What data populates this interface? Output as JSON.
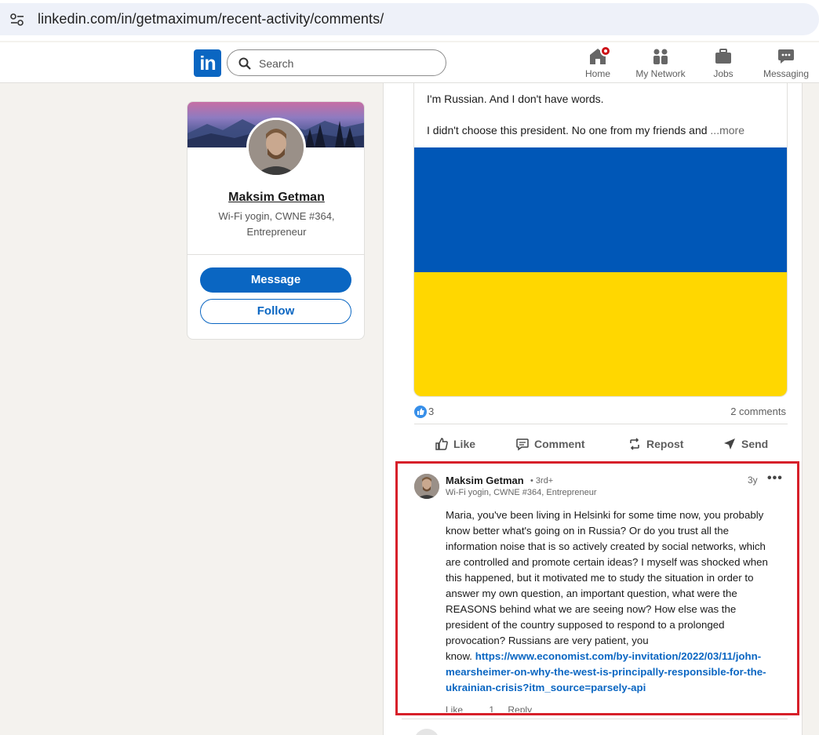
{
  "browser": {
    "url": "linkedin.com/in/getmaximum/recent-activity/comments/"
  },
  "header": {
    "logo": "in",
    "search_placeholder": "Search",
    "nav": [
      {
        "label": "Home",
        "icon": "home-icon"
      },
      {
        "label": "My Network",
        "icon": "network-icon"
      },
      {
        "label": "Jobs",
        "icon": "briefcase-icon"
      },
      {
        "label": "Messaging",
        "icon": "messaging-icon"
      }
    ]
  },
  "profile": {
    "name": "Maksim Getman",
    "headline": "Wi-Fi yogin, CWNE #364, Entrepreneur",
    "message_label": "Message",
    "follow_label": "Follow"
  },
  "post": {
    "line1": "I'm Russian. And I don't have words.",
    "line2": "I didn't choose this president. No one from my friends and",
    "more_label": "...more",
    "reaction_count": "3",
    "comments_label": "2 comments",
    "actions": [
      "Like",
      "Comment",
      "Repost",
      "Send"
    ],
    "flag_colors": {
      "top": "#0057b7",
      "bottom": "#ffd700"
    }
  },
  "comment": {
    "author": "Maksim Getman",
    "degree": "• 3rd+",
    "headline": "Wi-Fi yogin, CWNE #364, Entrepreneur",
    "time": "3y",
    "menu": "•••",
    "lines": [
      "Maria, you've been living in Helsinki for some time now, you probably",
      "know better what's going on in Russia? Or do you trust all the",
      "information noise that is so actively created by social networks, which",
      "are controlled and promote certain ideas? I myself was shocked when",
      "this happened, but it motivated me to study the situation in order to",
      "answer my own question, an important question, what were the",
      "REASONS behind what we are seeing now? How else was the",
      "president of the country supposed to respond to a prolonged",
      "provocation? Russians are very patient, you"
    ],
    "last_line_text": "know.",
    "link_lines": [
      "https://www.economist.com/by-invitation/2022/03/11/john-",
      "mearsheimer-on-why-the-west-is-principally-responsible-for-the-",
      "ukrainian-crisis?itm_source=parsely-api"
    ],
    "footer": {
      "like": "Like",
      "count": "1",
      "reply": "Reply"
    }
  },
  "colors": {
    "brand": "#0a66c2",
    "highlight_frame": "#d7202a"
  }
}
